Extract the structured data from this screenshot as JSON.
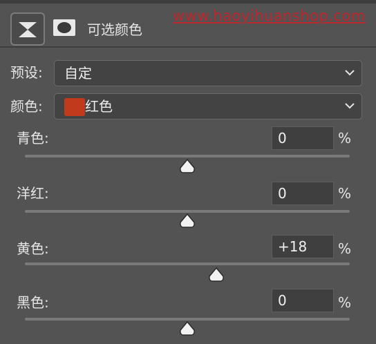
{
  "header": {
    "title": "可选颜色",
    "watermark": "www.haoyihuanshop.com",
    "adjustment_icon": "selective-color-adjustment-icon",
    "mask_icon": "layer-mask-icon"
  },
  "preset": {
    "label": "预设:",
    "value": "自定"
  },
  "colors": {
    "label": "颜色:",
    "value": "红色",
    "swatch_color": "#c23a1c"
  },
  "sliders": [
    {
      "label": "青色:",
      "value": "0",
      "unit": "%",
      "numeric": 0
    },
    {
      "label": "洋红:",
      "value": "0",
      "unit": "%",
      "numeric": 0
    },
    {
      "label": "黄色:",
      "value": "+18",
      "unit": "%",
      "numeric": 18
    },
    {
      "label": "黑色:",
      "value": "0",
      "unit": "%",
      "numeric": 0
    }
  ],
  "slider_range": [
    -100,
    100
  ]
}
